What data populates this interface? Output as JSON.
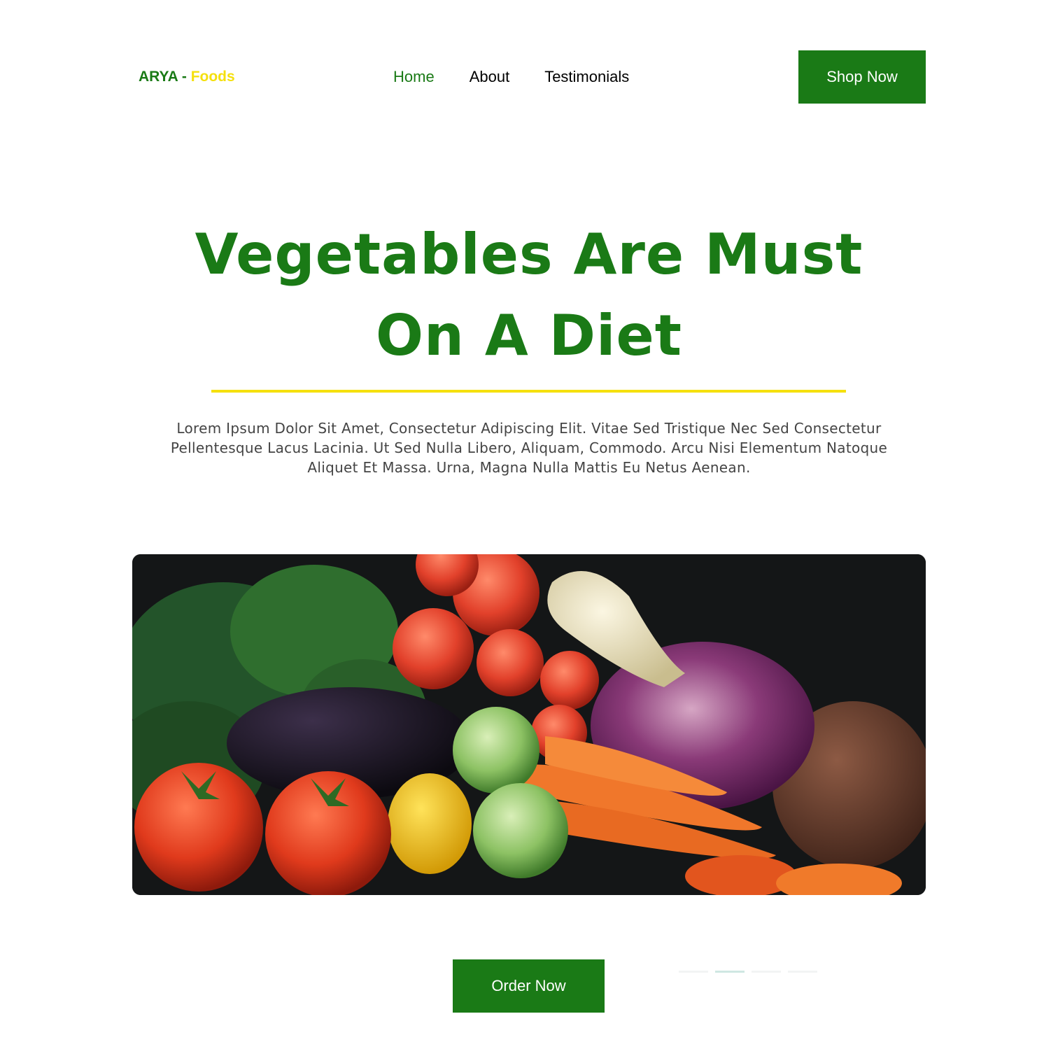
{
  "header": {
    "logo": {
      "brand": "ARYA",
      "separator": " - ",
      "accent": "Foods"
    },
    "nav": [
      {
        "label": "Home",
        "active": true
      },
      {
        "label": "About",
        "active": false
      },
      {
        "label": "Testimonials",
        "active": false
      }
    ],
    "cta_label": "Shop Now"
  },
  "hero": {
    "title_line1": "Vegetables Are Must",
    "title_line2": "On A Diet",
    "description": "Lorem Ipsum Dolor Sit Amet, Consectetur Adipiscing Elit. Vitae Sed Tristique Nec Sed Consectetur Pellentesque Lacus Lacinia. Ut Sed Nulla Libero, Aliquam, Commodo. Arcu Nisi Elementum Natoque Aliquet Et Massa. Urna, Magna Nulla Mattis Eu Netus Aenean.",
    "image_alt": "vegetables-photo"
  },
  "order_label": "Order Now",
  "carousel": {
    "count": 4,
    "active_index": 1
  },
  "colors": {
    "primary": "#1a7a16",
    "accent": "#f5e00e",
    "text": "#444444"
  }
}
